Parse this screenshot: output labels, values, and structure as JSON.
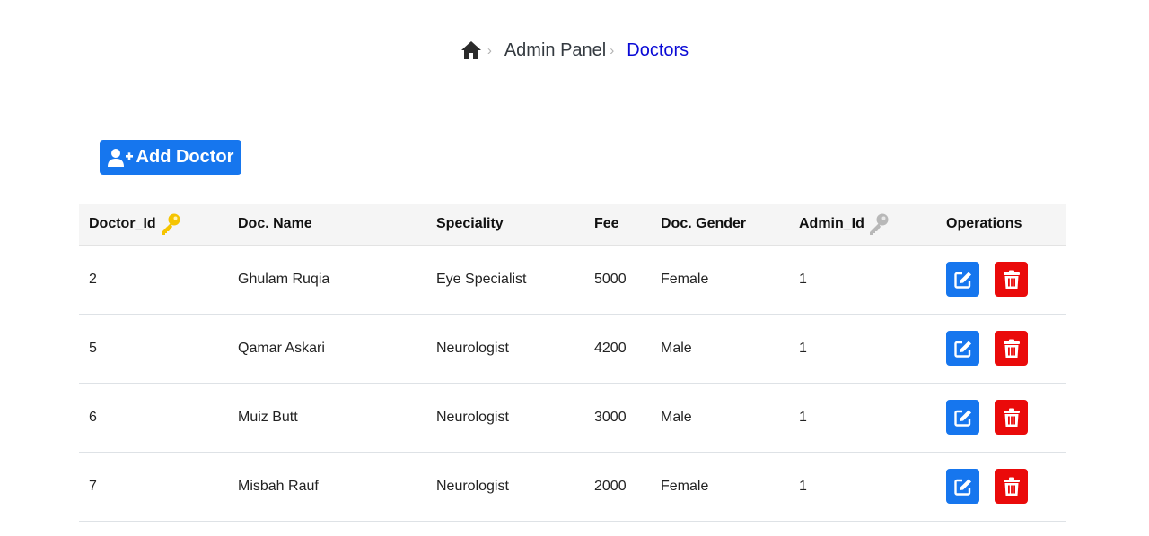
{
  "breadcrumb": {
    "home_icon": "home-icon",
    "items": [
      {
        "label": "Admin Panel"
      },
      {
        "label": "Doctors"
      }
    ],
    "separator": "›",
    "active_color": "#0a0ad6"
  },
  "toolbar": {
    "add_label": "Add Doctor",
    "add_icon": "user-plus-icon",
    "accent_color": "#1676ee"
  },
  "table": {
    "columns": [
      "Doctor_Id",
      "Doc. Name",
      "Speciality",
      "Fee",
      "Doc. Gender",
      "Admin_Id",
      "Operations"
    ],
    "primary_key_icon": "key-icon-gold",
    "foreign_key_icon": "key-icon-grey",
    "rows": [
      {
        "id": "2",
        "name": "Ghulam Ruqia",
        "speciality": "Eye Specialist",
        "fee": "5000",
        "gender": "Female",
        "admin_id": "1"
      },
      {
        "id": "5",
        "name": "Qamar Askari",
        "speciality": "Neurologist",
        "fee": "4200",
        "gender": "Male",
        "admin_id": "1"
      },
      {
        "id": "6",
        "name": "Muiz Butt",
        "speciality": "Neurologist",
        "fee": "3000",
        "gender": "Male",
        "admin_id": "1"
      },
      {
        "id": "7",
        "name": "Misbah Rauf",
        "speciality": "Neurologist",
        "fee": "2000",
        "gender": "Female",
        "admin_id": "1"
      }
    ],
    "edit_icon": "edit-icon",
    "delete_icon": "trash-icon",
    "edit_color": "#1676ee",
    "delete_color": "#ea0a0a"
  }
}
